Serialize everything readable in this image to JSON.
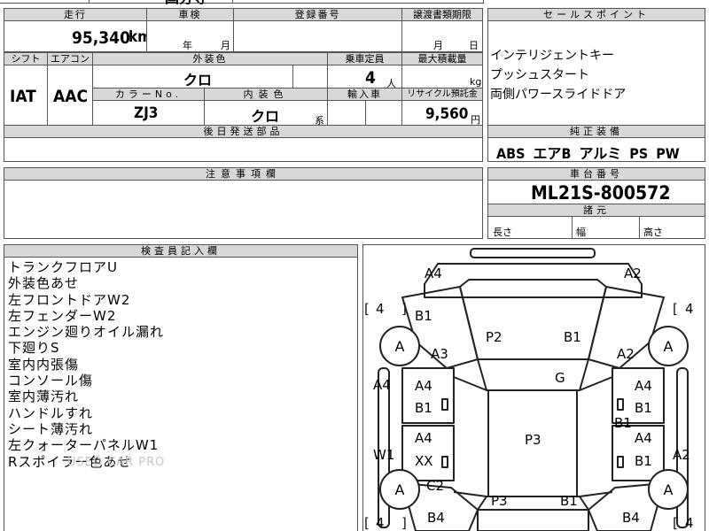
{
  "top_cut": {
    "left_text": "国分寺",
    "mid_text": ""
  },
  "mileage": {
    "header": "走行",
    "value": "95,340",
    "unit": "km"
  },
  "inspection": {
    "header": "車検",
    "year_unit": "年",
    "month_unit": "月"
  },
  "registration": {
    "header": "登録番号"
  },
  "transfer": {
    "header": "譲渡書類期限",
    "month_unit": "月",
    "day_unit": "日"
  },
  "shift": {
    "header": "シフト",
    "value": "IAT"
  },
  "aircon": {
    "header": "エアコン",
    "value": "AAC"
  },
  "exterior": {
    "header": "外装色",
    "value": "クロ"
  },
  "capacity": {
    "header": "乗車定員",
    "value": "4",
    "unit": "人"
  },
  "max_load": {
    "header": "最大積載量",
    "unit": "kg"
  },
  "color_no": {
    "header": "カラーNo.",
    "value": "ZJ3"
  },
  "interior": {
    "header": "内装色",
    "value": "クロ",
    "suffix": "系"
  },
  "import": {
    "header": "輸入車"
  },
  "recycle": {
    "header": "リサイクル預託金",
    "value": "9,560",
    "unit": "円"
  },
  "later_parts": {
    "header": "後日発送部品"
  },
  "sales_points": {
    "header": "セールスポイント",
    "lines": [
      "インテリジェントキー",
      "プッシュスタート",
      "両側パワースライドドア"
    ]
  },
  "equipment": {
    "header": "純正装備",
    "value": "ABS エアB アルミ PS PW"
  },
  "caution": {
    "header": "注意事項欄"
  },
  "chassis": {
    "header": "車台番号",
    "value": "ML21S-800572"
  },
  "dimensions": {
    "header": "諸元",
    "length": "長さ",
    "width": "幅",
    "height": "高さ"
  },
  "inspector": {
    "header": "検査員記入欄",
    "notes": [
      "トランクフロアU",
      "外装色あせ",
      "左フロントドアW2",
      "左フェンダーW2",
      "エンジン廻りオイル漏れ",
      "下廻りS",
      "室内内張傷",
      "コンソール傷",
      "室内薄汚れ",
      "ハンドルすれ",
      "シート薄汚れ",
      "左クォーターパネルW1",
      "Rスポイラー色あせ"
    ],
    "watermark": "USED CAR PRO"
  },
  "diagram": {
    "labels": {
      "a4_tl": "A4",
      "a2_tr": "A2",
      "b1_fl": "B1",
      "p2": "P2",
      "b1_hood": "B1",
      "a3": "A3",
      "a2_r": "A2",
      "g": "G",
      "a4_l": "A4",
      "a4_fd_l": "A4",
      "b1_fd_l": "B1",
      "a4_fd_r": "A4",
      "b1_fd_r": "B1",
      "b1_mid": "B1",
      "p3_roof": "P3",
      "w1": "W1",
      "a4_rd_l": "A4",
      "xx": "XX",
      "a4_rd_r": "A4",
      "b1_rd_r": "B1",
      "a2_rr": "A2",
      "c2": "C2",
      "p3_rear": "P3",
      "b1_rear": "B1",
      "b4_bl": "B4",
      "b4_br": "B4"
    },
    "tires": {
      "fl": "A",
      "fr": "A",
      "rl": "A",
      "rr": "A"
    },
    "tire_depth": {
      "fl": "4",
      "fr": "4",
      "rl": "4",
      "rr": "4"
    }
  }
}
